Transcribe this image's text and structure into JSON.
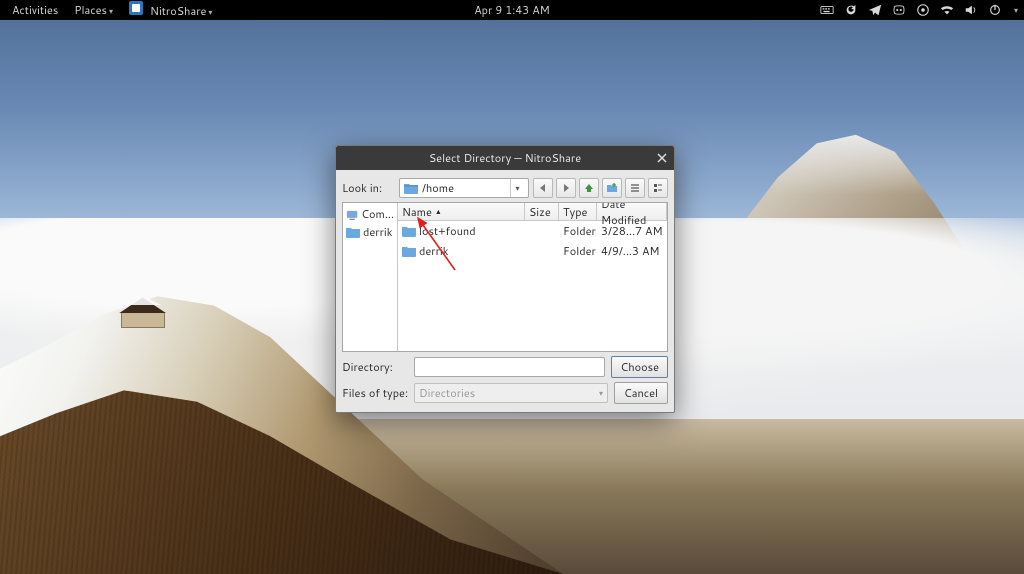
{
  "topbar": {
    "activities": "Activities",
    "places": "Places",
    "app_name": "NitroShare",
    "datetime": "Apr 9  1:43 AM"
  },
  "dialog": {
    "title": "Select Directory — NitroShare",
    "lookin_label": "Look in:",
    "path": "/home",
    "sidebar": {
      "computer": "Com...",
      "user": "derrik"
    },
    "columns": {
      "name": "Name",
      "size": "Size",
      "type": "Type",
      "date": "Date Modified"
    },
    "rows": [
      {
        "name": "lost+found",
        "type": "Folder",
        "date": "3/28...7 AM"
      },
      {
        "name": "derrik",
        "type": "Folder",
        "date": "4/9/...3 AM"
      }
    ],
    "directory_label": "Directory:",
    "directory_value": "",
    "filetype_label": "Files of type:",
    "filetype_value": "Directories",
    "choose": "Choose",
    "cancel": "Cancel"
  }
}
